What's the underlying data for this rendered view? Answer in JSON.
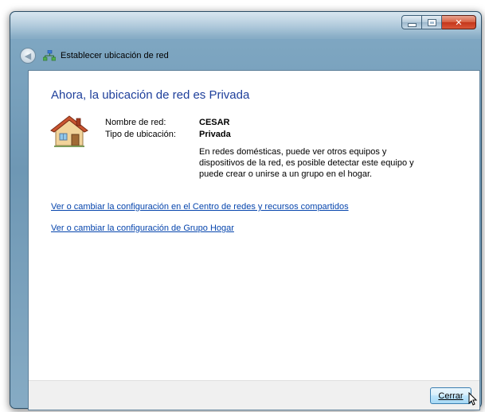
{
  "window": {
    "title": "Establecer ubicación de red",
    "caption_buttons": [
      "minimize",
      "maximize",
      "close"
    ]
  },
  "main": {
    "heading": "Ahora, la ubicación de red es Privada",
    "network_name_label": "Nombre de red:",
    "network_name_value": "CESAR",
    "location_type_label": "Tipo de ubicación:",
    "location_type_value": "Privada",
    "description": "En redes domésticas, puede ver otros equipos y dispositivos de la red, es posible detectar este equipo y puede crear o unirse a un grupo en el hogar.",
    "link_network_center": "Ver o cambiar la configuración en el Centro de redes y recursos compartidos",
    "link_homegroup": "Ver o cambiar la configuración de Grupo Hogar"
  },
  "footer": {
    "close_button_label": "Cerrar"
  },
  "icons": {
    "back": "back-arrow-icon",
    "network": "network-icon",
    "house": "house-icon",
    "cursor": "mouse-cursor-icon"
  },
  "colors": {
    "heading": "#1e3f9b",
    "link": "#0645ad",
    "frame": "#7fa7c2",
    "close": "#c4361a"
  }
}
